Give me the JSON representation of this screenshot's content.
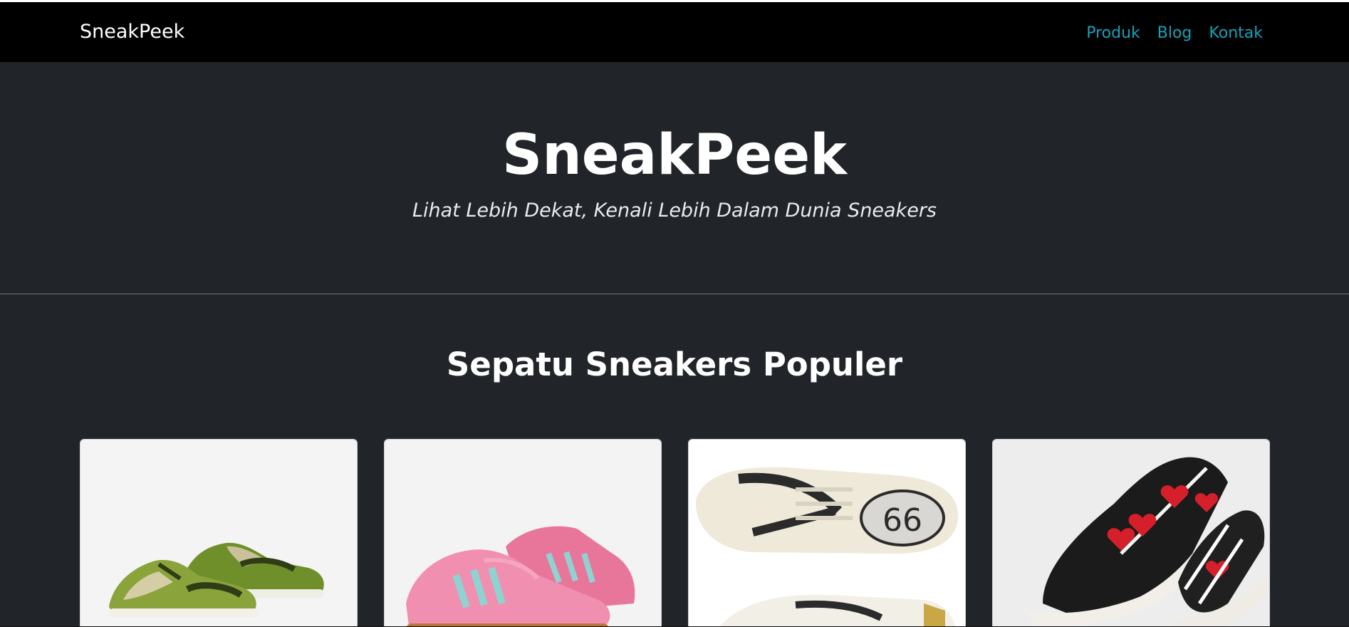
{
  "navbar": {
    "brand": "SneakPeek",
    "links": [
      "Produk",
      "Blog",
      "Kontak"
    ]
  },
  "hero": {
    "title": "SneakPeek",
    "subtitle": "Lihat Lebih Dekat, Kenali Lebih Dalam Dunia Sneakers"
  },
  "products": {
    "heading": "Sepatu Sneakers Populer"
  },
  "colors": {
    "navbar_bg": "#000000",
    "page_bg": "#212529",
    "link": "#17a2b8",
    "text": "#ffffff"
  }
}
